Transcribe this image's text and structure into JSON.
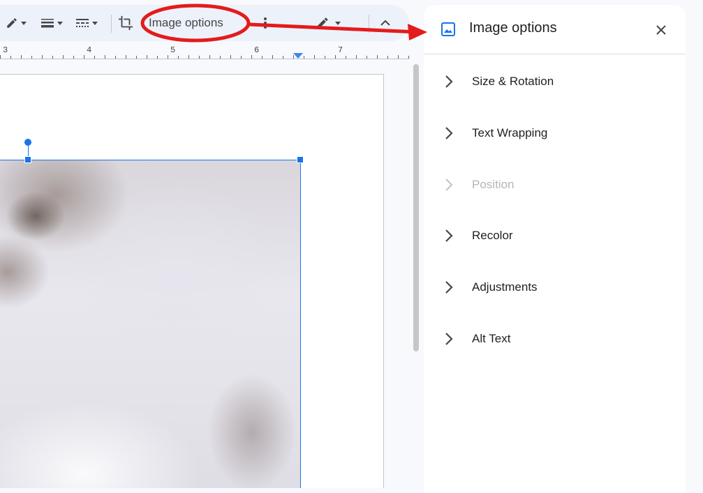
{
  "toolbar": {
    "image_options_label": "Image options",
    "icons": [
      "pencil-icon",
      "line-weight-icon",
      "line-dash-icon",
      "crop-icon",
      "more-vert-icon",
      "edit-pencil-icon",
      "chevron-up-icon"
    ]
  },
  "ruler": {
    "numbers": [
      "3",
      "4",
      "5",
      "6",
      "7"
    ]
  },
  "panel": {
    "title": "Image options",
    "sections": [
      {
        "label": "Size & Rotation",
        "enabled": true
      },
      {
        "label": "Text Wrapping",
        "enabled": true
      },
      {
        "label": "Position",
        "enabled": false
      },
      {
        "label": "Recolor",
        "enabled": true
      },
      {
        "label": "Adjustments",
        "enabled": true
      },
      {
        "label": "Alt Text",
        "enabled": true
      }
    ]
  },
  "colors": {
    "accent": "#1a73e8",
    "annotation": "#e41b1b",
    "toolbar_bg": "#edf2fa",
    "disabled_text": "#b5b5b5"
  }
}
